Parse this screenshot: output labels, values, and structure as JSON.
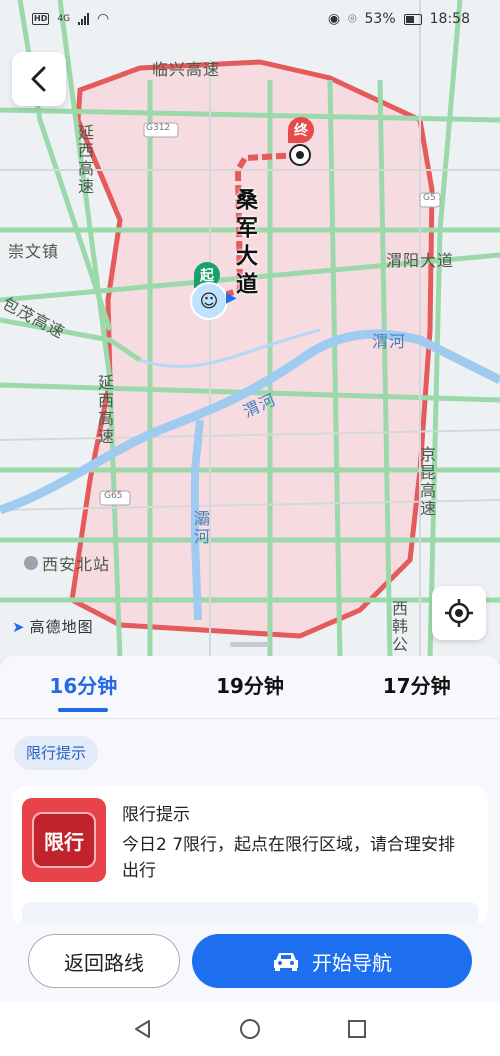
{
  "status_bar": {
    "hd": "HD",
    "network": "4G",
    "battery": "53%",
    "time": "18:58"
  },
  "map": {
    "labels": {
      "linxing": "临兴高速",
      "yanxi_top": "延西高速",
      "chongwen": "崇文镇",
      "baomao": "包茂高速",
      "yanxi_bottom": "延西高速",
      "weiyang": "渭阳大道",
      "weihe_right": "渭河",
      "weihe_mid": "渭河",
      "bahe": "灞河",
      "jingkun": "京昆高速",
      "xian_north": "西安北站",
      "xihan": "西韩公",
      "g312": "G312",
      "g5": "G5",
      "g65": "G65",
      "amap": "高德地图"
    },
    "road_name": "桑军大道",
    "start_marker": "起",
    "end_marker": "终",
    "colors": {
      "route": "#e55a5a",
      "restricted_area": "#f6d6dc",
      "highway": "#8fd6a2"
    }
  },
  "sheet": {
    "tabs": [
      {
        "label": "16分钟",
        "active": true
      },
      {
        "label": "19分钟",
        "active": false
      },
      {
        "label": "17分钟",
        "active": false
      }
    ],
    "chip": "限行提示",
    "notice": {
      "icon_text": "限行",
      "title": "限行提示",
      "text": "今日2 7限行，起点在限行区域，请合理安排出行"
    }
  },
  "actions": {
    "return_label": "返回路线",
    "start_label": "开始导航",
    "accent": "#1e6ff0"
  },
  "icons": [
    "back-arrow-icon",
    "locate-icon",
    "car-icon",
    "nav-back-icon",
    "nav-home-icon",
    "nav-recents-icon"
  ]
}
